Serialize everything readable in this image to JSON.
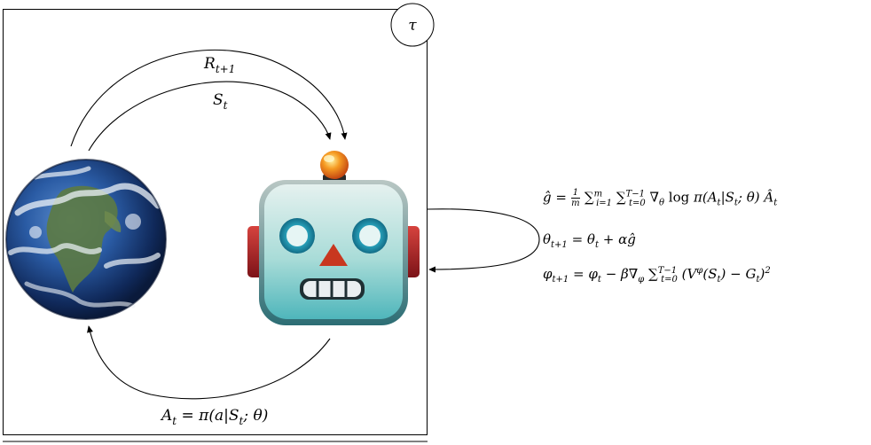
{
  "diagram": {
    "trajectory_symbol": "τ",
    "reward_label": "R_{t+1}",
    "state_label": "S_t",
    "action_label": "A_t = π(a|S_t; θ)",
    "environment_icon": "earth-globe-icon",
    "agent_icon": "robot-face-icon",
    "equations": [
      "ĝ = (1/m) Σ_{i=1}^{m} Σ_{t=0}^{T−1} ∇_θ log π(A_t|S_t; θ) Â_t",
      "θ_{t+1} = θ_t + αĝ",
      "φ_{t+1} = φ_t − β∇_φ Σ_{t=0}^{T−1} (V^φ(S_t) − G_t)^2"
    ]
  },
  "colors": {
    "robot_face_top": "#cfe6e3",
    "robot_face_bottom": "#5cbcc0",
    "robot_eye_ring": "#1f8fa6",
    "robot_nose": "#c8371f",
    "robot_ear": "#a8242a",
    "antenna_ball": "#f5821f",
    "earth_ocean": "#1d3f7a"
  }
}
